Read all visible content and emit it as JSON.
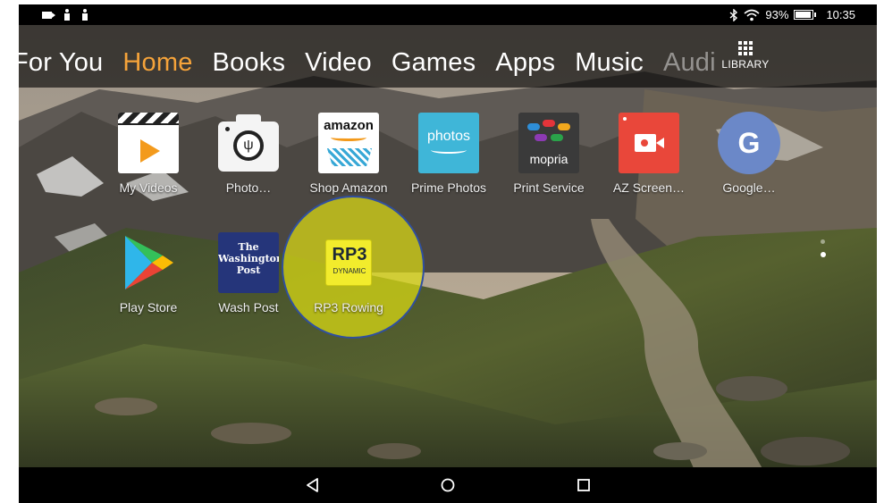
{
  "status_bar": {
    "left_icons": [
      "camera-icon",
      "person-icon",
      "person-icon"
    ],
    "right_icons": [
      "bluetooth-icon",
      "wifi-icon",
      "battery-icon"
    ],
    "battery_percent": "93%",
    "battery_level": 0.93,
    "time": "10:35"
  },
  "nav": {
    "tabs": [
      {
        "label": "For You"
      },
      {
        "label": "Home",
        "active": true
      },
      {
        "label": "Books"
      },
      {
        "label": "Video"
      },
      {
        "label": "Games"
      },
      {
        "label": "Apps"
      },
      {
        "label": "Music"
      },
      {
        "label": "Audi"
      }
    ],
    "library_label": "LIBRARY",
    "active_color": "#f5a33a"
  },
  "apps": [
    {
      "label": "My Videos",
      "icon": "my-videos-icon"
    },
    {
      "label": "Photo…",
      "icon": "camera-icon"
    },
    {
      "label": "Shop Amazon",
      "icon": "amazon-icon",
      "icon_text": "amazon"
    },
    {
      "label": "Prime Photos",
      "icon": "prime-photos-icon",
      "icon_text": "photos"
    },
    {
      "label": "Print Service",
      "icon": "mopria-icon",
      "icon_text": "mopria"
    },
    {
      "label": "AZ Screen…",
      "icon": "screen-recorder-icon"
    },
    {
      "label": "Google…",
      "icon": "google-settings-icon",
      "icon_text": "G"
    },
    {
      "label": "Play Store",
      "icon": "play-store-icon"
    },
    {
      "label": "Wash Post",
      "icon": "washington-post-icon",
      "icon_text": "The Washington Post"
    },
    {
      "label": "RP3 Rowing",
      "icon": "rp3-icon",
      "icon_text": "RP3",
      "icon_subtext": "DYNAMIC"
    }
  ],
  "highlight": {
    "target": "RP3 Rowing",
    "color": "#dcdc14"
  },
  "page_indicator": {
    "pages": 2,
    "current": 2
  },
  "bottom_nav": {
    "buttons": [
      "back-icon",
      "home-icon",
      "recents-icon"
    ]
  }
}
